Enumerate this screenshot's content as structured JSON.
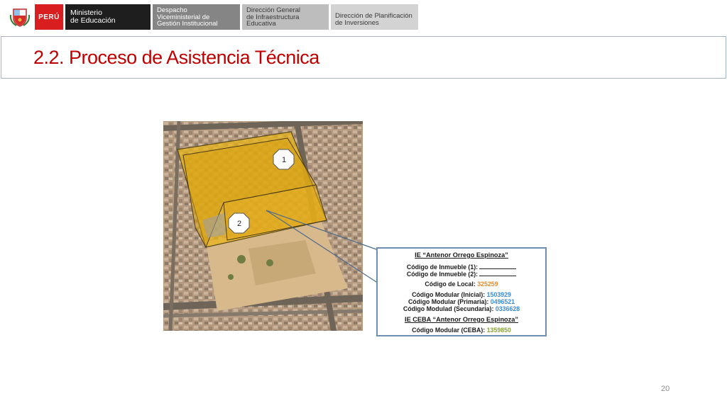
{
  "header": {
    "country": "PERÚ",
    "ministry_line1": "Ministerio",
    "ministry_line2": "de Educación",
    "b1_line1": "Despacho",
    "b1_line2": "Viceministerial de",
    "b1_line3": "Gestión Institucional",
    "b2_line1": "Dirección General",
    "b2_line2": "de Infraestructura",
    "b2_line3": "Educativa",
    "b3_line1": "Dirección de Planificación",
    "b3_line2": "de Inversiones"
  },
  "title": "2.2. Proceso de Asistencia Técnica",
  "map": {
    "marker1": "1",
    "marker2": "2"
  },
  "info": {
    "ie_heading": "IE “Antenor Orrego Espinoza”",
    "inmueble1_label": "Código de Inmueble (1):",
    "inmueble2_label": "Código de Inmueble (2):",
    "local_label": "Código de Local:",
    "local_value": "325259",
    "inicial_label": "Código Modular (Inicial):",
    "inicial_value": "1503929",
    "primaria_label": "Código Modular (Primaria):",
    "primaria_value": "0496521",
    "secundaria_label": "Código Modulad (Secundaria):",
    "secundaria_value": "0336628",
    "ceba_heading": "IE CEBA “Antenor Orrego Espinoza”",
    "ceba_label": "Código Modular (CEBA):",
    "ceba_value": "1359850"
  },
  "page_number": "20",
  "colors": {
    "title_red": "#c00000",
    "peru_red": "#d81e1e",
    "overlay_yellow": "#e8b41a"
  }
}
